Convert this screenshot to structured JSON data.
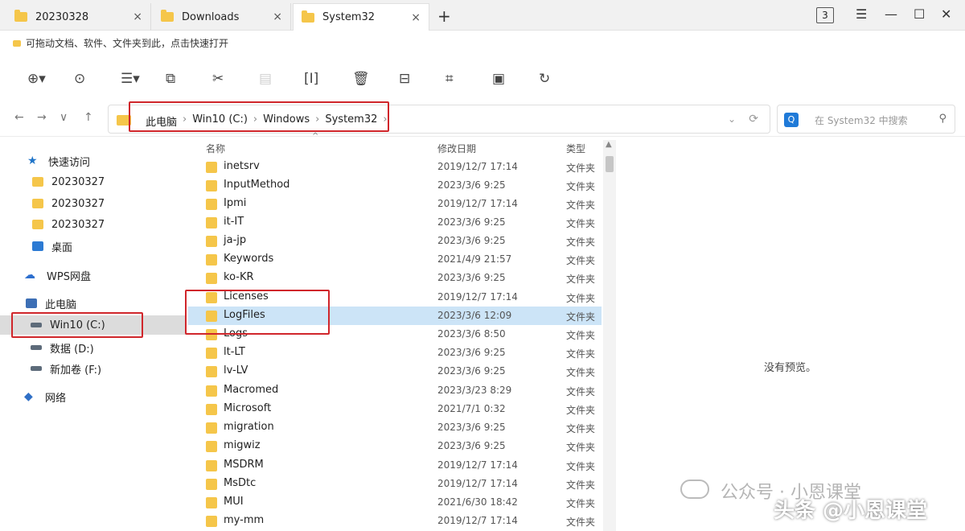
{
  "tabs": [
    {
      "label": "20230328",
      "close": "×",
      "active": false
    },
    {
      "label": "Downloads",
      "close": "×",
      "active": false
    },
    {
      "label": "System32",
      "close": "×",
      "active": true
    }
  ],
  "new_tab": "+",
  "window": {
    "count": "3",
    "menu": "☰",
    "minimize": "—",
    "maximize": "☐",
    "close": "✕"
  },
  "favorites_bar": {
    "hint": "可拖动文档、软件、文件夹到此，点击快速打开"
  },
  "toolbar": {
    "icons": [
      "new-icon",
      "view-icon",
      "list-icon",
      "copy-icon",
      "cut-icon",
      "paste-icon",
      "rename-icon",
      "delete-icon",
      "properties-icon",
      "crop-icon",
      "save-icon",
      "refresh-icon"
    ]
  },
  "nav": {
    "back": "←",
    "forward": "→",
    "history": "∨",
    "up": "↑"
  },
  "breadcrumb": [
    "此电脑",
    "Win10 (C:)",
    "Windows",
    "System32"
  ],
  "breadcrumb_sep": "›",
  "address_dropdown": "⌄",
  "address_refresh": "⟳",
  "search": {
    "icon_glyph": "Q",
    "placeholder": "在 System32 中搜索",
    "glass": "⚲"
  },
  "sidebar": {
    "items": [
      {
        "label": "快速访问",
        "icon": "star-icon",
        "glyph": "★"
      },
      {
        "label": "20230327",
        "icon": "folder-icon"
      },
      {
        "label": "20230327",
        "icon": "folder-icon"
      },
      {
        "label": "20230327",
        "icon": "folder-icon"
      },
      {
        "label": "桌面",
        "icon": "desktop-icon"
      },
      {
        "label": "WPS网盘",
        "icon": "cloud-icon",
        "glyph": "☁"
      },
      {
        "label": "此电脑",
        "icon": "computer-icon"
      },
      {
        "label": "Win10 (C:)",
        "icon": "drive-icon",
        "selected": true
      },
      {
        "label": "数据 (D:)",
        "icon": "drive-icon"
      },
      {
        "label": "新加卷 (F:)",
        "icon": "drive-icon"
      },
      {
        "label": "网络",
        "icon": "network-icon",
        "glyph": "◆"
      }
    ]
  },
  "columns": {
    "name": "名称",
    "date": "修改日期",
    "type": "类型",
    "sort_arrow": "^"
  },
  "files": [
    {
      "name": "inetsrv",
      "date": "2019/12/7 17:14",
      "type": "文件夹"
    },
    {
      "name": "InputMethod",
      "date": "2023/3/6 9:25",
      "type": "文件夹"
    },
    {
      "name": "Ipmi",
      "date": "2019/12/7 17:14",
      "type": "文件夹"
    },
    {
      "name": "it-IT",
      "date": "2023/3/6 9:25",
      "type": "文件夹"
    },
    {
      "name": "ja-jp",
      "date": "2023/3/6 9:25",
      "type": "文件夹"
    },
    {
      "name": "Keywords",
      "date": "2021/4/9 21:57",
      "type": "文件夹"
    },
    {
      "name": "ko-KR",
      "date": "2023/3/6 9:25",
      "type": "文件夹"
    },
    {
      "name": "Licenses",
      "date": "2019/12/7 17:14",
      "type": "文件夹"
    },
    {
      "name": "LogFiles",
      "date": "2023/3/6 12:09",
      "type": "文件夹",
      "selected": true
    },
    {
      "name": "Logs",
      "date": "2023/3/6 8:50",
      "type": "文件夹"
    },
    {
      "name": "lt-LT",
      "date": "2023/3/6 9:25",
      "type": "文件夹"
    },
    {
      "name": "lv-LV",
      "date": "2023/3/6 9:25",
      "type": "文件夹"
    },
    {
      "name": "Macromed",
      "date": "2023/3/23 8:29",
      "type": "文件夹"
    },
    {
      "name": "Microsoft",
      "date": "2021/7/1 0:32",
      "type": "文件夹"
    },
    {
      "name": "migration",
      "date": "2023/3/6 9:25",
      "type": "文件夹"
    },
    {
      "name": "migwiz",
      "date": "2023/3/6 9:25",
      "type": "文件夹"
    },
    {
      "name": "MSDRM",
      "date": "2019/12/7 17:14",
      "type": "文件夹"
    },
    {
      "name": "MsDtc",
      "date": "2019/12/7 17:14",
      "type": "文件夹"
    },
    {
      "name": "MUI",
      "date": "2021/6/30 18:42",
      "type": "文件夹"
    },
    {
      "name": "my-mm",
      "date": "2019/12/7 17:14",
      "type": "文件夹"
    }
  ],
  "preview": {
    "message": "没有预览。"
  },
  "watermark": {
    "line1": "公众号 · 小恩课堂",
    "line2": "头条 @小恩课堂"
  },
  "colors": {
    "highlight": "#d0262b",
    "selection": "#cce4f7",
    "folder": "#f5c64a"
  }
}
